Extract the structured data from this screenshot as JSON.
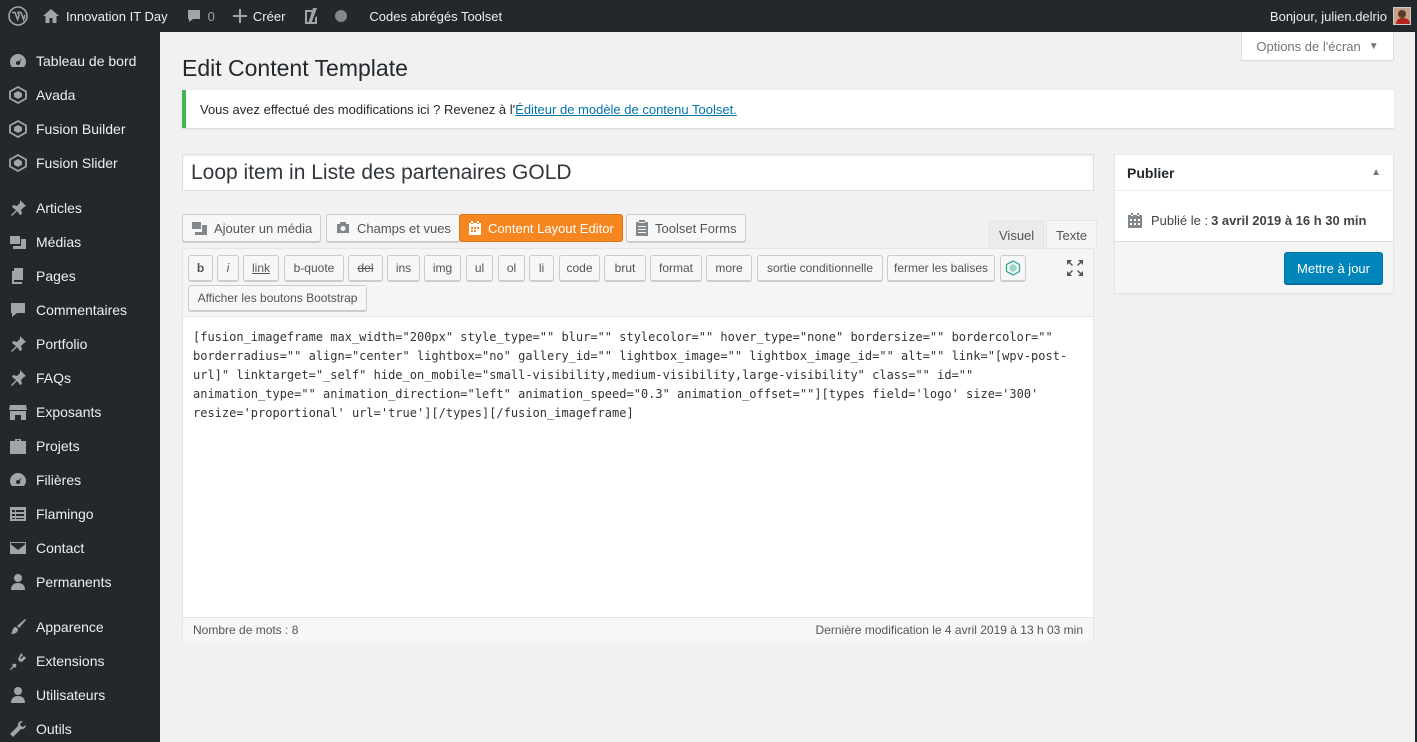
{
  "adminbar": {
    "site_name": "Innovation IT Day",
    "comments_count": "0",
    "new_label": "Créer",
    "toolset_label": "Codes abrégés Toolset",
    "greeting": "Bonjour, julien.delrio"
  },
  "sidebar": {
    "items": [
      {
        "label": "Tableau de bord",
        "icon": "dashboard-icon"
      },
      {
        "label": "Avada",
        "icon": "avada-icon"
      },
      {
        "label": "Fusion Builder",
        "icon": "fusion-builder-icon"
      },
      {
        "label": "Fusion Slider",
        "icon": "fusion-slider-icon"
      },
      {
        "label": "Articles",
        "icon": "pin-icon"
      },
      {
        "label": "Médias",
        "icon": "media-icon"
      },
      {
        "label": "Pages",
        "icon": "pages-icon"
      },
      {
        "label": "Commentaires",
        "icon": "comments-icon"
      },
      {
        "label": "Portfolio",
        "icon": "pin-icon"
      },
      {
        "label": "FAQs",
        "icon": "pin-icon"
      },
      {
        "label": "Exposants",
        "icon": "store-icon"
      },
      {
        "label": "Projets",
        "icon": "portfolio-icon"
      },
      {
        "label": "Filières",
        "icon": "dashboard-icon"
      },
      {
        "label": "Flamingo",
        "icon": "list-icon"
      },
      {
        "label": "Contact",
        "icon": "mail-icon"
      },
      {
        "label": "Permanents",
        "icon": "user-icon"
      },
      {
        "label": "Apparence",
        "icon": "brush-icon"
      },
      {
        "label": "Extensions",
        "icon": "plugin-icon"
      },
      {
        "label": "Utilisateurs",
        "icon": "user-icon"
      },
      {
        "label": "Outils",
        "icon": "wrench-icon"
      }
    ]
  },
  "screen_options": "Options de l'écran",
  "page_title": "Edit Content Template",
  "notice": {
    "text": "Vous avez effectué des modifications ici ? Revenez à l'",
    "link": "Éditeur de modèle de contenu Toolset."
  },
  "post_title": "Loop item in Liste des partenaires GOLD",
  "media_buttons": {
    "add_media": "Ajouter un média",
    "fields_views": "Champs et vues",
    "layout_editor": "Content Layout Editor",
    "toolset_forms": "Toolset Forms"
  },
  "editor_tabs": {
    "visual": "Visuel",
    "text": "Texte"
  },
  "quicktags": [
    "b",
    "i",
    "link",
    "b-quote",
    "del",
    "ins",
    "img",
    "ul",
    "ol",
    "li",
    "code",
    "brut",
    "format",
    "more",
    "sortie conditionnelle",
    "fermer les balises"
  ],
  "bootstrap_button": "Afficher les boutons Bootstrap",
  "editor_content": "[fusion_imageframe max_width=\"200px\" style_type=\"\" blur=\"\" stylecolor=\"\" hover_type=\"none\" bordersize=\"\" bordercolor=\"\" borderradius=\"\" align=\"center\" lightbox=\"no\" gallery_id=\"\" lightbox_image=\"\" lightbox_image_id=\"\" alt=\"\" link=\"[wpv-post-url]\" linktarget=\"_self\" hide_on_mobile=\"small-visibility,medium-visibility,large-visibility\" class=\"\" id=\"\" animation_type=\"\" animation_direction=\"left\" animation_speed=\"0.3\" animation_offset=\"\"][types field='logo' size='300' resize='proportional' url='true'][/types][/fusion_imageframe]",
  "status": {
    "word_count": "Nombre de mots : 8",
    "last_modified": "Dernière modification le 4 avril 2019 à 13 h 03 min"
  },
  "publish": {
    "title": "Publier",
    "date_label": "Publié le : ",
    "date_value": "3 avril 2019 à 16 h 30 min",
    "update_button": "Mettre à jour"
  },
  "colors": {
    "admin_dark": "#23282d",
    "primary_blue": "#0085ba",
    "toolset_orange": "#f6861f",
    "notice_green": "#46b450"
  }
}
